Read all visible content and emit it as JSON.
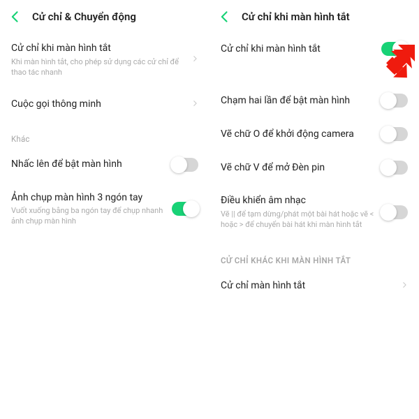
{
  "colors": {
    "accent": "#18d276",
    "arrow": "#ef1b0e"
  },
  "left": {
    "title": "Cử chỉ & Chuyển động",
    "rows": {
      "screen_off": {
        "title": "Cử chỉ khi màn hình tắt",
        "sub": "Khi màn hình tắt, cho phép sử dụng các cử chỉ để thao tác nhanh"
      },
      "smart_call": {
        "title": "Cuộc gọi thông minh"
      }
    },
    "section_other": "Khác",
    "rows2": {
      "raise_wake": {
        "title": "Nhấc lên để bật màn hình",
        "on": false
      },
      "three_finger": {
        "title": "Ảnh chụp màn hình 3 ngón tay",
        "sub": "Vuốt xuống bằng ba ngón tay để chụp nhanh ảnh chụp màn hình",
        "on": true
      }
    }
  },
  "right": {
    "title": "Cử chỉ khi màn hình tắt",
    "rows": {
      "master": {
        "title": "Cử chỉ khi màn hình tắt",
        "on": true
      },
      "double_tap": {
        "title": "Chạm hai lần để bật màn hình",
        "on": false
      },
      "draw_o": {
        "title": "Vẽ chữ O để khởi động camera",
        "on": false
      },
      "draw_v": {
        "title": "Vẽ chữ V để mở Đèn pin",
        "on": false
      },
      "music": {
        "title": "Điều khiển âm nhạc",
        "sub": "Vẽ || để tạm dừng/phát một bài hát hoặc vẽ < hoặc > để chuyển bài hát khi màn hình tắt",
        "on": false
      }
    },
    "section_other": "CỬ CHỈ KHÁC KHI MÀN HÌNH TẮT",
    "rows2": {
      "off_gestures": {
        "title": "Cử chỉ màn hình tắt"
      }
    }
  }
}
